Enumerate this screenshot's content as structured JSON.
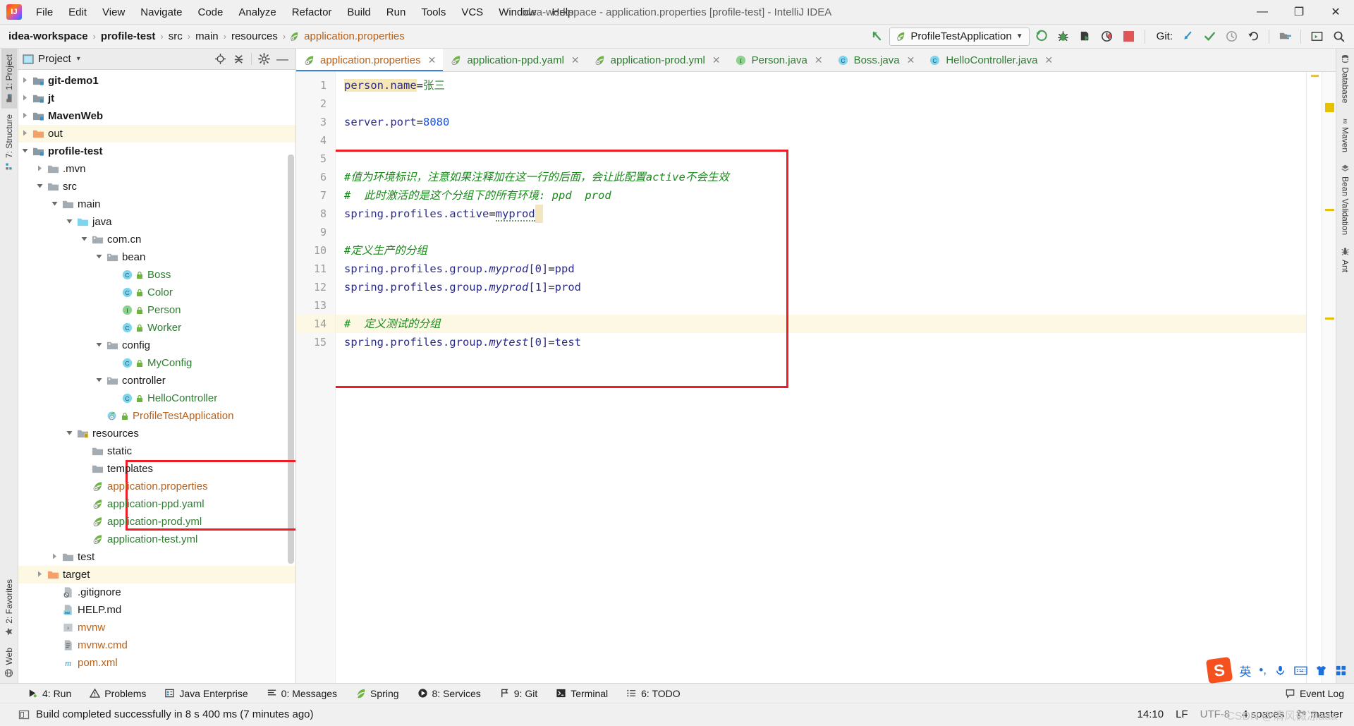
{
  "window": {
    "title": "idea-workspace - application.properties [profile-test] - IntelliJ IDEA",
    "logo_text": "IJ",
    "minimize": "—",
    "maximize": "❐",
    "close": "✕"
  },
  "menu": {
    "items": [
      "File",
      "Edit",
      "View",
      "Navigate",
      "Code",
      "Analyze",
      "Refactor",
      "Build",
      "Run",
      "Tools",
      "VCS",
      "Window",
      "Help"
    ]
  },
  "breadcrumb": {
    "items": [
      "idea-workspace",
      "profile-test",
      "src",
      "main",
      "resources",
      "application.properties"
    ],
    "separator": "›"
  },
  "toolbar": {
    "run_config": "ProfileTestApplication",
    "dropdown_caret": "▼",
    "git_label": "Git:",
    "icons": [
      "run-icon",
      "debug-icon",
      "run-with-coverage-icon",
      "profiler-icon",
      "stop-icon",
      "git-update-icon",
      "git-commit-icon",
      "git-history-icon",
      "undo-icon",
      "project-structure-icon",
      "terminal-icon",
      "search-everywhere-icon"
    ]
  },
  "left_strip": {
    "tabs": [
      {
        "label": "1: Project",
        "key": "1",
        "active": true,
        "icon": "project-icon"
      },
      {
        "label": "7: Structure",
        "key": "7",
        "active": false,
        "icon": "structure-icon"
      }
    ],
    "bottom_tabs": [
      {
        "label": "2: Favorites",
        "key": "2",
        "icon": "star-icon"
      },
      {
        "label": "Web",
        "key": "",
        "icon": "globe-icon"
      }
    ]
  },
  "right_strip": {
    "tabs": [
      {
        "label": "Database",
        "icon": "database-icon"
      },
      {
        "label": "Maven",
        "icon": "maven-icon"
      },
      {
        "label": "Bean Validation",
        "icon": "bean-validation-icon"
      },
      {
        "label": "Ant",
        "icon": "ant-icon"
      }
    ]
  },
  "project_panel": {
    "title": "Project",
    "caret": "▾",
    "actions": [
      "locate-icon",
      "collapse-all-icon",
      "settings-icon",
      "hide-icon"
    ],
    "tree": [
      {
        "label": "git-demo1",
        "indent": 1,
        "arrow": "collapsed",
        "icon": "module-folder",
        "bold": true,
        "color": "dark"
      },
      {
        "label": "jt",
        "indent": 1,
        "arrow": "collapsed",
        "icon": "module-folder",
        "bold": true,
        "color": "dark"
      },
      {
        "label": "MavenWeb",
        "indent": 1,
        "arrow": "collapsed",
        "icon": "module-folder",
        "bold": true,
        "color": "dark"
      },
      {
        "label": "out",
        "indent": 1,
        "arrow": "collapsed",
        "icon": "excluded-folder",
        "bold": false,
        "color": "dark",
        "highlight": true
      },
      {
        "label": "profile-test",
        "indent": 1,
        "arrow": "expanded",
        "icon": "module-folder",
        "bold": true,
        "color": "dark"
      },
      {
        "label": ".mvn",
        "indent": 2,
        "arrow": "collapsed",
        "icon": "folder",
        "bold": false,
        "color": "dark"
      },
      {
        "label": "src",
        "indent": 2,
        "arrow": "expanded",
        "icon": "folder",
        "bold": false,
        "color": "dark"
      },
      {
        "label": "main",
        "indent": 3,
        "arrow": "expanded",
        "icon": "folder",
        "bold": false,
        "color": "dark"
      },
      {
        "label": "java",
        "indent": 4,
        "arrow": "expanded",
        "icon": "source-folder",
        "bold": false,
        "color": "dark"
      },
      {
        "label": "com.cn",
        "indent": 5,
        "arrow": "expanded",
        "icon": "package",
        "bold": false,
        "color": "dark"
      },
      {
        "label": "bean",
        "indent": 6,
        "arrow": "expanded",
        "icon": "package",
        "bold": false,
        "color": "dark"
      },
      {
        "label": "Boss",
        "indent": 7,
        "arrow": "none",
        "icon": "class",
        "bold": false,
        "color": "green"
      },
      {
        "label": "Color",
        "indent": 7,
        "arrow": "none",
        "icon": "class",
        "bold": false,
        "color": "green"
      },
      {
        "label": "Person",
        "indent": 7,
        "arrow": "none",
        "icon": "interface",
        "bold": false,
        "color": "green"
      },
      {
        "label": "Worker",
        "indent": 7,
        "arrow": "none",
        "icon": "class",
        "bold": false,
        "color": "green"
      },
      {
        "label": "config",
        "indent": 6,
        "arrow": "expanded",
        "icon": "package",
        "bold": false,
        "color": "dark"
      },
      {
        "label": "MyConfig",
        "indent": 7,
        "arrow": "none",
        "icon": "class",
        "bold": false,
        "color": "green"
      },
      {
        "label": "controller",
        "indent": 6,
        "arrow": "expanded",
        "icon": "package",
        "bold": false,
        "color": "dark"
      },
      {
        "label": "HelloController",
        "indent": 7,
        "arrow": "none",
        "icon": "class",
        "bold": false,
        "color": "green"
      },
      {
        "label": "ProfileTestApplication",
        "indent": 6,
        "arrow": "none",
        "icon": "spring-class",
        "bold": false,
        "color": "orange"
      },
      {
        "label": "resources",
        "indent": 4,
        "arrow": "expanded",
        "icon": "resources-folder",
        "bold": false,
        "color": "dark"
      },
      {
        "label": "static",
        "indent": 5,
        "arrow": "none",
        "icon": "folder",
        "bold": false,
        "color": "dark"
      },
      {
        "label": "templates",
        "indent": 5,
        "arrow": "none",
        "icon": "folder",
        "bold": false,
        "color": "dark"
      },
      {
        "label": "application.properties",
        "indent": 5,
        "arrow": "none",
        "icon": "spring-file",
        "bold": false,
        "color": "orange"
      },
      {
        "label": "application-ppd.yaml",
        "indent": 5,
        "arrow": "none",
        "icon": "spring-file",
        "bold": false,
        "color": "green"
      },
      {
        "label": "application-prod.yml",
        "indent": 5,
        "arrow": "none",
        "icon": "spring-file",
        "bold": false,
        "color": "green"
      },
      {
        "label": "application-test.yml",
        "indent": 5,
        "arrow": "none",
        "icon": "spring-file",
        "bold": false,
        "color": "green"
      },
      {
        "label": "test",
        "indent": 3,
        "arrow": "collapsed",
        "icon": "folder",
        "bold": false,
        "color": "dark"
      },
      {
        "label": "target",
        "indent": 2,
        "arrow": "collapsed",
        "icon": "excluded-folder",
        "bold": false,
        "color": "dark",
        "highlight": true
      },
      {
        "label": ".gitignore",
        "indent": 3,
        "arrow": "none",
        "icon": "gitignore-file",
        "bold": false,
        "color": "dark"
      },
      {
        "label": "HELP.md",
        "indent": 3,
        "arrow": "none",
        "icon": "md-file",
        "bold": false,
        "color": "dark"
      },
      {
        "label": "mvnw",
        "indent": 3,
        "arrow": "none",
        "icon": "script-file",
        "bold": false,
        "color": "orange"
      },
      {
        "label": "mvnw.cmd",
        "indent": 3,
        "arrow": "none",
        "icon": "cmd-file",
        "bold": false,
        "color": "orange"
      },
      {
        "label": "pom.xml",
        "indent": 3,
        "arrow": "none",
        "icon": "maven-file",
        "bold": false,
        "color": "orange"
      }
    ]
  },
  "editor": {
    "tabs": [
      {
        "label": "application.properties",
        "icon": "spring-file",
        "active": true,
        "color": "props"
      },
      {
        "label": "application-ppd.yaml",
        "icon": "spring-file",
        "active": false,
        "color": "yaml"
      },
      {
        "label": "application-prod.yml",
        "icon": "spring-file",
        "active": false,
        "color": "yaml"
      },
      {
        "label": "Person.java",
        "icon": "interface",
        "active": false,
        "color": "java"
      },
      {
        "label": "Boss.java",
        "icon": "class",
        "active": false,
        "color": "java"
      },
      {
        "label": "HelloController.java",
        "icon": "class",
        "active": false,
        "color": "java"
      }
    ],
    "close_glyph": "✕",
    "lines": [
      {
        "n": 1,
        "type": "kv",
        "key": "person.name",
        "value": "张三",
        "key_highlight": true,
        "value_kind": "str"
      },
      {
        "n": 2,
        "type": "blank"
      },
      {
        "n": 3,
        "type": "kv",
        "key": "server.port",
        "value": "8080",
        "value_kind": "num"
      },
      {
        "n": 4,
        "type": "blank"
      },
      {
        "n": 5,
        "type": "blank"
      },
      {
        "n": 6,
        "type": "comment",
        "text": "#值为环境标识，注意如果注释加在这一行的后面，会让此配置active不会生效"
      },
      {
        "n": 7,
        "type": "comment",
        "text": "#  此时激活的是这个分组下的所有环境: ppd  prod"
      },
      {
        "n": 8,
        "type": "kv",
        "key": "spring.profiles.active",
        "value": "myprod",
        "value_kind": "squiggle",
        "caret": true
      },
      {
        "n": 9,
        "type": "blank"
      },
      {
        "n": 10,
        "type": "comment",
        "text": "#定义生产的分组"
      },
      {
        "n": 11,
        "type": "kv_italic",
        "key_prefix": "spring.profiles.group.",
        "key_italic": "myprod",
        "key_suffix": "[0]",
        "value": "ppd"
      },
      {
        "n": 12,
        "type": "kv_italic",
        "key_prefix": "spring.profiles.group.",
        "key_italic": "myprod",
        "key_suffix": "[1]",
        "value": "prod"
      },
      {
        "n": 13,
        "type": "blank"
      },
      {
        "n": 14,
        "type": "comment",
        "text": "#  定义测试的分组",
        "highlight": true
      },
      {
        "n": 15,
        "type": "kv_italic",
        "key_prefix": "spring.profiles.group.",
        "key_italic": "mytest",
        "key_suffix": "[0]",
        "value": "test"
      }
    ],
    "annotation_box_color": "#ee1c25"
  },
  "bottom_tool_window": {
    "items": [
      {
        "label": "4: Run",
        "key": "4",
        "icon": "run-icon"
      },
      {
        "label": "Problems",
        "key": "",
        "icon": "problems-icon"
      },
      {
        "label": "Java Enterprise",
        "key": "",
        "icon": "java-enterprise-icon"
      },
      {
        "label": "0: Messages",
        "key": "0",
        "icon": "messages-icon"
      },
      {
        "label": "Spring",
        "key": "",
        "icon": "spring-icon"
      },
      {
        "label": "8: Services",
        "key": "8",
        "icon": "services-icon"
      },
      {
        "label": "9: Git",
        "key": "9",
        "icon": "git-icon"
      },
      {
        "label": "Terminal",
        "key": "",
        "icon": "terminal-icon"
      },
      {
        "label": "6: TODO",
        "key": "6",
        "icon": "todo-icon"
      }
    ],
    "event_log": "Event Log"
  },
  "status_bar": {
    "message": "Build completed successfully in 8 s 400 ms (7 minutes ago)",
    "time": "14:10",
    "line_separator": "LF",
    "encoding": "UTF-8",
    "indent": "4 spaces",
    "branch": "master"
  },
  "ime": {
    "logo": "S",
    "mode": "英",
    "icons": [
      "punctuation-icon",
      "voice-input-icon",
      "soft-keyboard-icon",
      "skin-icon",
      "apps-icon"
    ]
  },
  "watermark": "CSDN @清风微凉aaa"
}
